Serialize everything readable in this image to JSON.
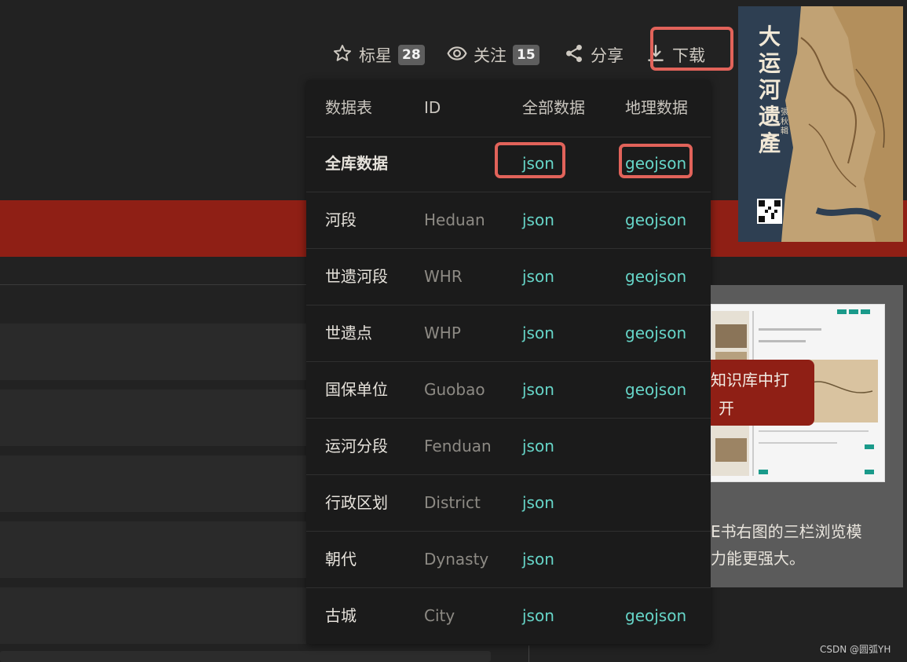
{
  "actions": {
    "star": {
      "label": "标星",
      "count": "28"
    },
    "watch": {
      "label": "关注",
      "count": "15"
    },
    "share": {
      "label": "分享"
    },
    "download": {
      "label": "下载"
    }
  },
  "table": {
    "headers": [
      "数据表",
      "ID",
      "全部数据",
      "地理数据"
    ],
    "rows": [
      {
        "name": "全库数据",
        "id": "",
        "all": "json",
        "geo": "geojson"
      },
      {
        "name": "河段",
        "id": "Heduan",
        "all": "json",
        "geo": "geojson"
      },
      {
        "name": "世遗河段",
        "id": "WHR",
        "all": "json",
        "geo": "geojson"
      },
      {
        "name": "世遗点",
        "id": "WHP",
        "all": "json",
        "geo": "geojson"
      },
      {
        "name": "国保单位",
        "id": "Guobao",
        "all": "json",
        "geo": "geojson"
      },
      {
        "name": "运河分段",
        "id": "Fenduan",
        "all": "json",
        "geo": ""
      },
      {
        "name": "行政区划",
        "id": "District",
        "all": "json",
        "geo": ""
      },
      {
        "name": "朝代",
        "id": "Dynasty",
        "all": "json",
        "geo": ""
      },
      {
        "name": "古城",
        "id": "City",
        "all": "json",
        "geo": "geojson"
      }
    ]
  },
  "cover": {
    "title_chars": [
      "大",
      "运",
      "河",
      "遗",
      "產"
    ],
    "subtitle": "張秋輯"
  },
  "panel": {
    "open_button_line1": "知识库中打",
    "open_button_line2": "开",
    "text_line1": "E书右图的三栏浏览模",
    "text_line2": "力能更强大。"
  },
  "watermark": "CSDN @圆弧YH",
  "colors": {
    "accent_link": "#66d5c8",
    "highlight": "#e2635a",
    "brand_red": "#8f1f15"
  }
}
